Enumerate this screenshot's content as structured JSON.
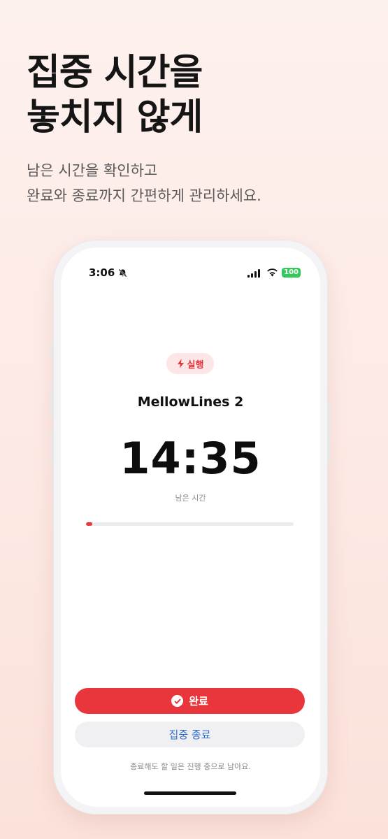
{
  "promo": {
    "headline_line1": "집중 시간을",
    "headline_line2": "놓치지 않게",
    "subcopy_line1": "남은 시간을 확인하고",
    "subcopy_line2": "완료와 종료까지 간편하게 관리하세요."
  },
  "status_bar": {
    "time": "3:06",
    "battery": "100",
    "icons": [
      "bell-slash-icon",
      "cellular-signal-icon",
      "wifi-icon",
      "battery-icon"
    ]
  },
  "session": {
    "badge_label": "실행",
    "badge_icon": "lightning-bolt-icon",
    "title": "MellowLines 2",
    "remaining_time": "14:35",
    "remaining_label": "남은 시간",
    "progress_fraction": 0.03
  },
  "actions": {
    "complete_label": "완료",
    "end_label": "집중 종료",
    "footnote": "종료해도 할 일은 진행 중으로 남아요."
  },
  "colors": {
    "accent": "#e8363c",
    "end_text": "#2f6fd0",
    "battery": "#34c759"
  }
}
